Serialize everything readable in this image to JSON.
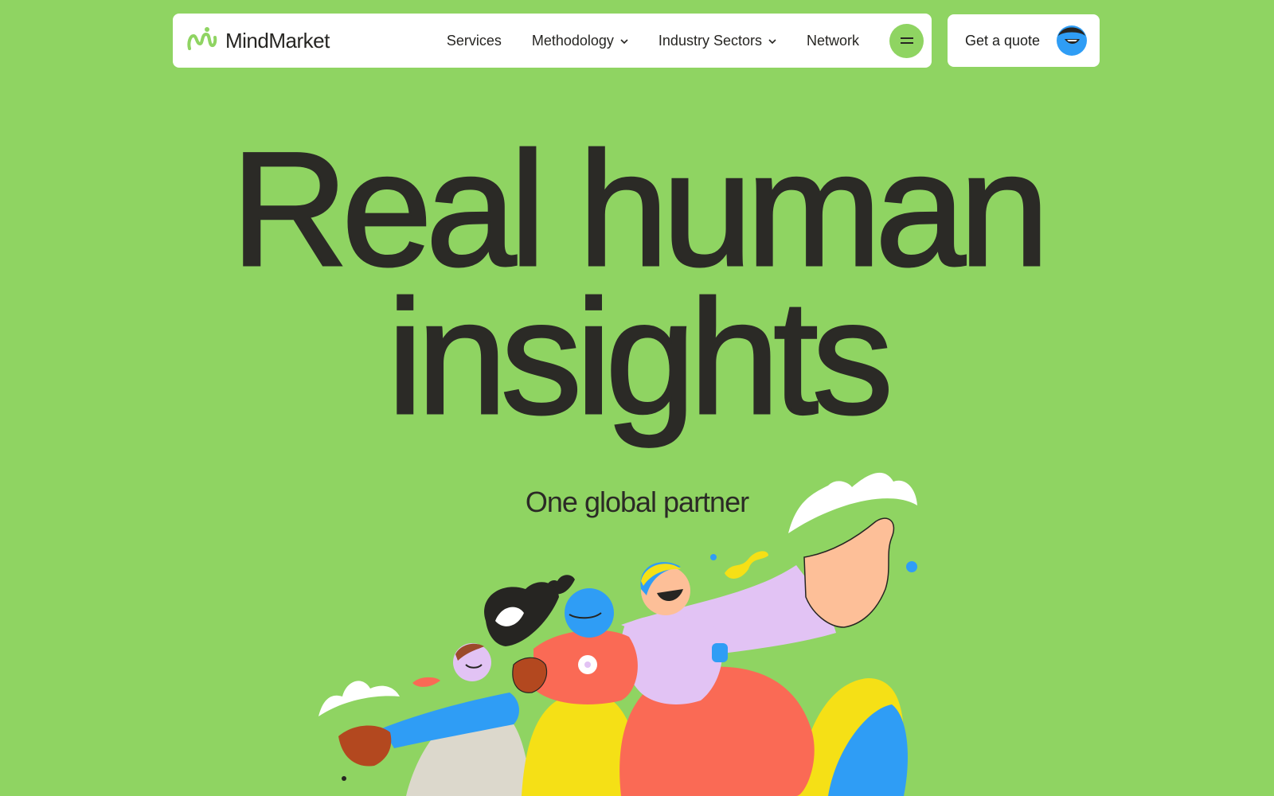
{
  "header": {
    "brand": "MindMarket",
    "nav": [
      {
        "label": "Services",
        "has_dropdown": false
      },
      {
        "label": "Methodology",
        "has_dropdown": true
      },
      {
        "label": "Industry Sectors",
        "has_dropdown": true
      },
      {
        "label": "Network",
        "has_dropdown": false
      }
    ],
    "menu_icon": "menu-icon",
    "cta_label": "Get a quote"
  },
  "hero": {
    "title_line1": "Real human",
    "title_line2": "insights",
    "subtitle": "One global partner"
  },
  "colors": {
    "background": "#8fd462",
    "text": "#2b2a26",
    "white": "#ffffff",
    "accent_blue": "#2f9df5",
    "accent_red": "#fa6a55",
    "accent_yellow": "#f5e016",
    "accent_lilac": "#e2c3f4",
    "skin": "#fdbf98"
  }
}
